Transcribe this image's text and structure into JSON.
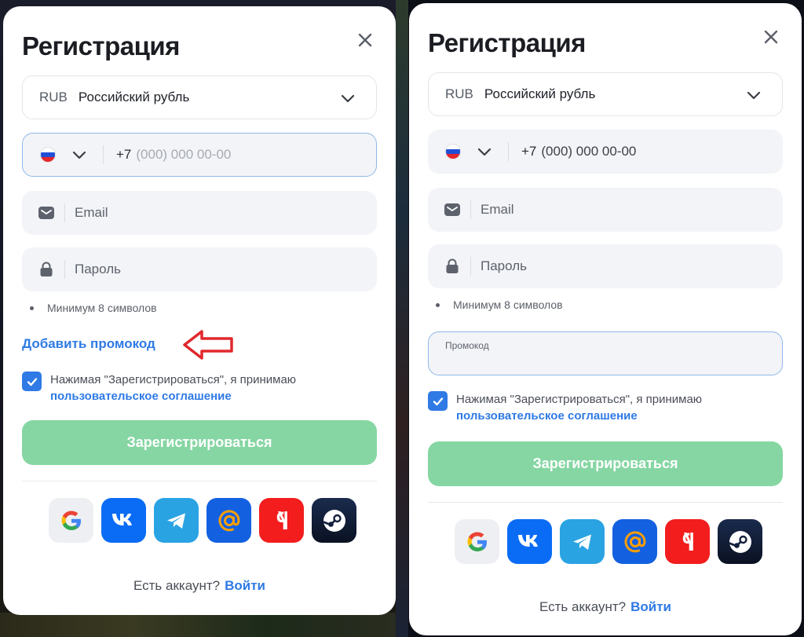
{
  "title": "Регистрация",
  "currency": {
    "code": "RUB",
    "name": "Российский рубль"
  },
  "phone": {
    "prefix": "+7",
    "placeholder": "(000) 000 00-00"
  },
  "email": {
    "placeholder": "Email"
  },
  "password": {
    "placeholder": "Пароль",
    "hint": "Минимум 8 символов"
  },
  "promo": {
    "link": "Добавить промокод",
    "label": "Промокод"
  },
  "agreement": {
    "text": "Нажимая \"Зарегистрироваться\", я принимаю",
    "link": "пользовательское соглашение",
    "checked": true
  },
  "submit": "Зарегистрироваться",
  "socials": [
    "google-icon",
    "vk-icon",
    "telegram-icon",
    "mail-ru-icon",
    "yandex-icon",
    "steam-icon"
  ],
  "account": {
    "question": "Есть аккаунт?",
    "login": "Войти"
  },
  "colors": {
    "accent": "#2f7ae5",
    "submit": "#86d6a3",
    "arrow": "#e0292d"
  }
}
